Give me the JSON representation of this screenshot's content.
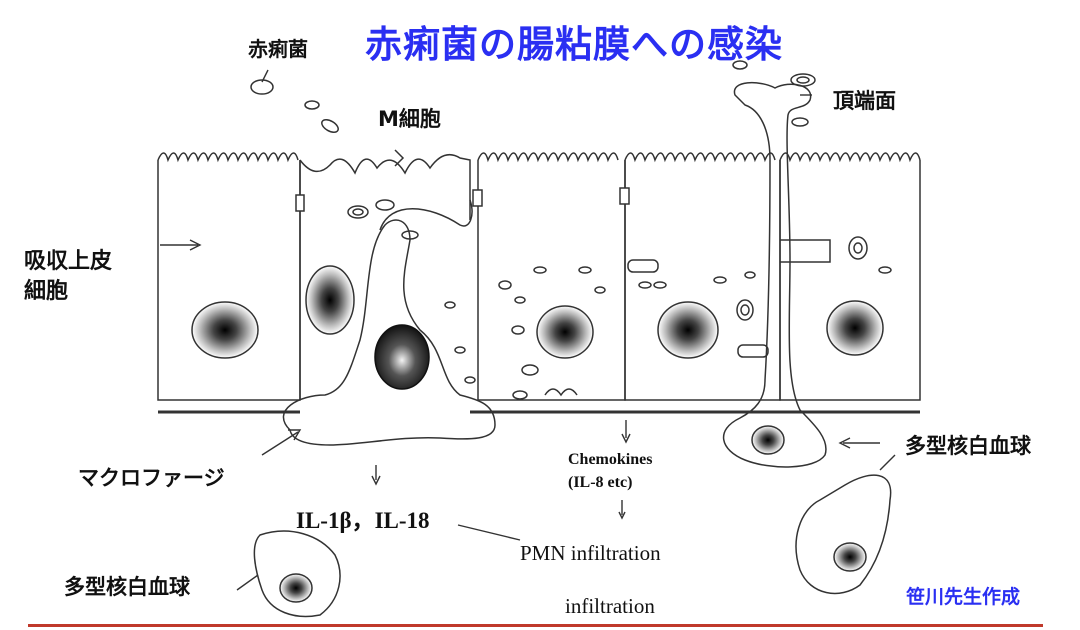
{
  "title": "赤痢菌の腸粘膜への感染",
  "labels": {
    "bacteria": "赤痢菌",
    "m_cell": "M細胞",
    "apical_surface": "頂端面",
    "absorptive_epithelium_line1": "吸収上皮",
    "absorptive_epithelium_line2": "細胞",
    "macrophage": "マクロファージ",
    "pmn_right": "多型核白血球",
    "pmn_left": "多型核白血球",
    "cytokines": "IL-1β，IL-18",
    "chemokines_line1": "Chemokines",
    "chemokines_line2": "(IL-8 etc)",
    "pmn_infiltration": "PMN infiltration",
    "infiltration": "infiltration",
    "credit": "笹川先生作成"
  },
  "colors": {
    "title": "#2a2ff2",
    "credit": "#2a2ff2",
    "bottom_line": "#c0392b",
    "line": "#333333"
  }
}
